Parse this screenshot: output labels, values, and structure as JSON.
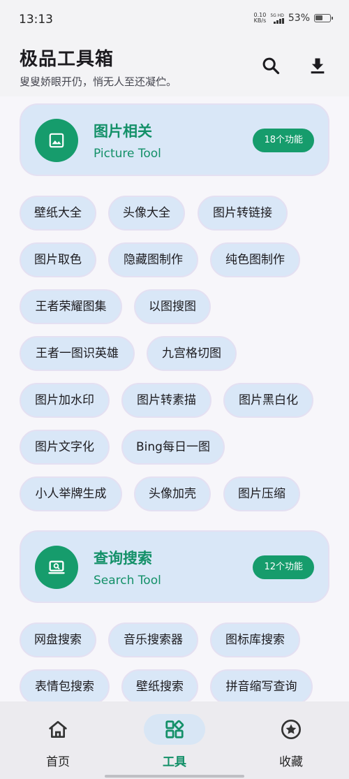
{
  "status": {
    "time": "13:13",
    "net_speed_value": "0.10",
    "net_speed_unit": "KB/s",
    "network_type": "5G HD",
    "battery": "53%"
  },
  "header": {
    "title": "极品工具箱",
    "subtitle": "叟叟娇眼开仍，悄无人至还凝伫。",
    "search_icon": "search-icon",
    "download_icon": "download-icon"
  },
  "sections": [
    {
      "title": "图片相关",
      "subtitle": "Picture Tool",
      "count": "18个功能",
      "icon": "image-icon",
      "tools": [
        "壁纸大全",
        "头像大全",
        "图片转链接",
        "图片取色",
        "隐藏图制作",
        "纯色图制作",
        "王者荣耀图集",
        "以图搜图",
        "王者一图识英雄",
        "九宫格切图",
        "图片加水印",
        "图片转素描",
        "图片黑白化",
        "图片文字化",
        "Bing每日一图",
        "小人举牌生成",
        "头像加壳",
        "图片压缩"
      ]
    },
    {
      "title": "查询搜索",
      "subtitle": "Search Tool",
      "count": "12个功能",
      "icon": "laptop-search-icon",
      "tools": [
        "网盘搜索",
        "音乐搜索器",
        "图标库搜索",
        "表情包搜索",
        "壁纸搜索",
        "拼音缩写查询"
      ]
    }
  ],
  "nav": {
    "items": [
      {
        "label": "首页",
        "icon": "home-icon",
        "active": false
      },
      {
        "label": "工具",
        "icon": "tools-grid-icon",
        "active": true
      },
      {
        "label": "收藏",
        "icon": "star-badge-icon",
        "active": false
      }
    ]
  },
  "colors": {
    "accent": "#169c6c",
    "card_bg": "#d9e7f7",
    "page_bg": "#f7f6fa"
  }
}
